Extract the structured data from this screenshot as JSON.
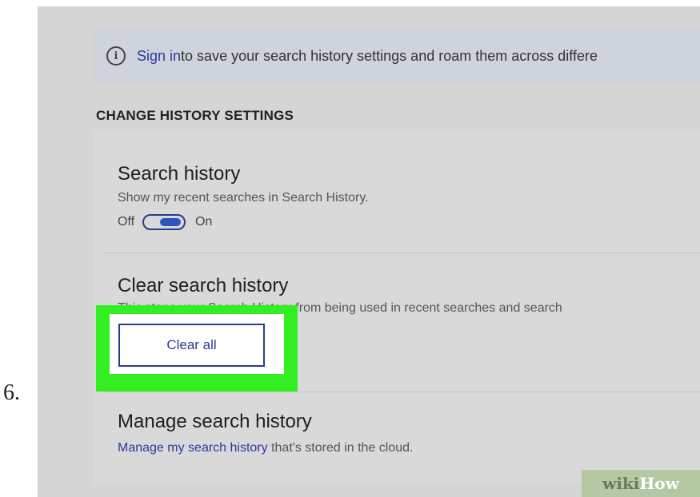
{
  "step_number": "6.",
  "banner": {
    "sign_in_link": "Sign in",
    "text": " to save your search history settings and roam them across differe"
  },
  "section_heading": "CHANGE HISTORY SETTINGS",
  "search_history": {
    "title": "Search history",
    "description": "Show my recent searches in Search History.",
    "toggle_off_label": "Off",
    "toggle_on_label": "On",
    "toggle_state": "on"
  },
  "clear_history": {
    "title": "Clear search history",
    "description": "This stops your Search History from being used in recent searches and search",
    "button_label": "Clear all"
  },
  "manage_history": {
    "title": "Manage search history",
    "link": "Manage my search history",
    "description": " that's stored in the cloud."
  },
  "watermark": {
    "part1": "wiki",
    "part2": "How"
  },
  "colors": {
    "highlight": "#33ee22",
    "link": "#2c3a9a",
    "toggle_knob": "#2b57b8"
  },
  "icons": [
    "info-icon",
    "toggle-switch"
  ]
}
